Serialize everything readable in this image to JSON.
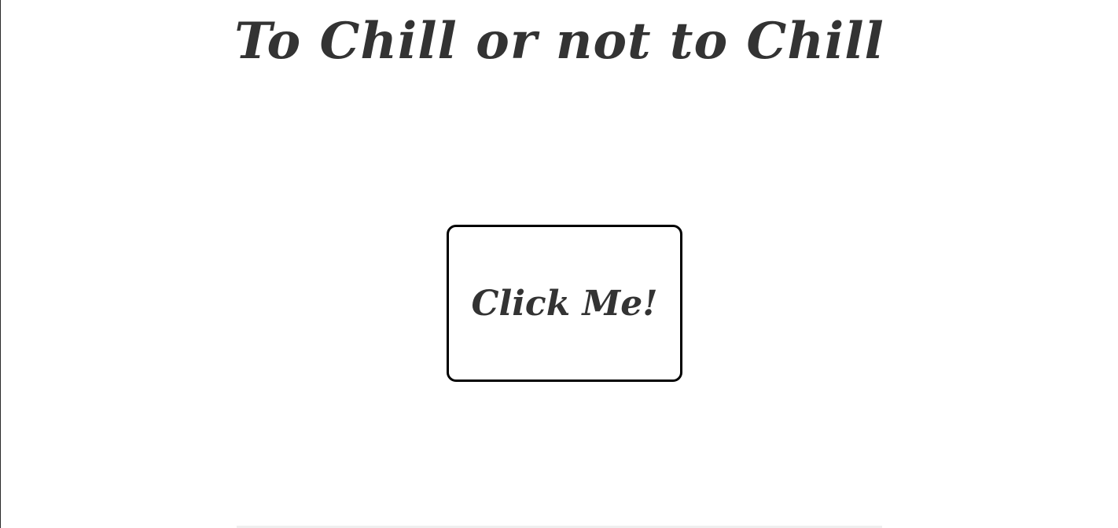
{
  "page": {
    "title": "To Chill or not to Chill"
  },
  "main": {
    "button_label": "Click Me!"
  },
  "colors": {
    "text": "#333333",
    "button_border": "#000000",
    "background": "#ffffff"
  }
}
